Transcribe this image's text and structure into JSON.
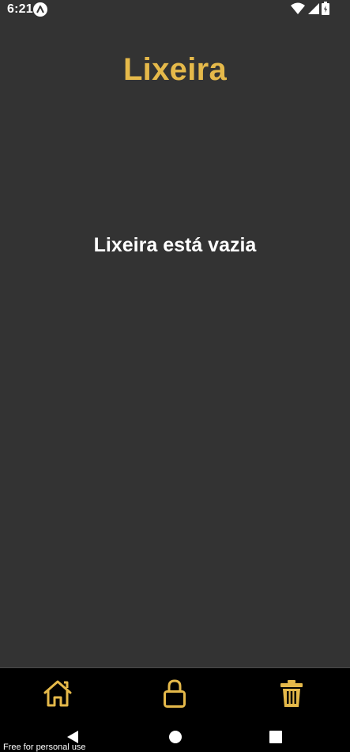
{
  "status_bar": {
    "time": "6:21",
    "app_icon": "app-notification-icon",
    "wifi_icon": "wifi-icon",
    "signal_icon": "cell-signal-icon",
    "battery_icon": "battery-icon"
  },
  "page": {
    "title": "Lixeira",
    "empty_message": "Lixeira está vazia"
  },
  "tab_bar": {
    "tabs": [
      {
        "name": "home",
        "icon": "home-icon"
      },
      {
        "name": "lock",
        "icon": "lock-icon"
      },
      {
        "name": "trash",
        "icon": "trash-icon",
        "active": true
      }
    ]
  },
  "nav_bar": {
    "back_icon": "back-triangle-icon",
    "home_icon": "home-circle-icon",
    "recents_icon": "recents-square-icon"
  },
  "watermark": "Free for personal use",
  "colors": {
    "background": "#333333",
    "accent": "#e5b94a",
    "bar": "#000000",
    "text": "#ffffff"
  }
}
